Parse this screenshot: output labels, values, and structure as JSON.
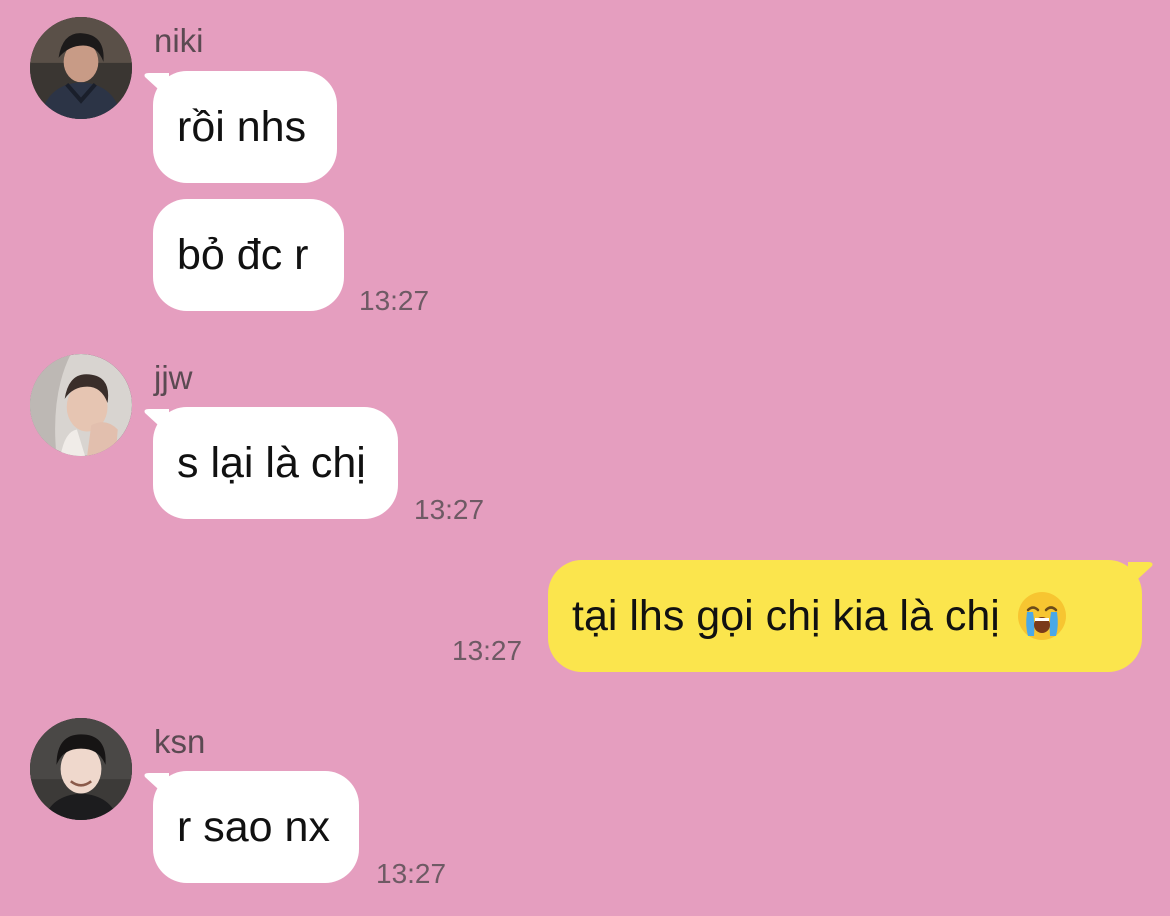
{
  "messages": [
    {
      "sender": "niki",
      "bubbles": [
        "rồi nhs",
        "bỏ đc r"
      ],
      "time": "13:27"
    },
    {
      "sender": "jjw",
      "bubbles": [
        "s lại là chị"
      ],
      "time": "13:27"
    },
    {
      "sender": "me",
      "bubbles": [
        "tại lhs gọi chị kia là chị"
      ],
      "emoji": "loudly-crying-face",
      "time": "13:27"
    },
    {
      "sender": "ksn",
      "bubbles": [
        "r sao nx"
      ],
      "time": "13:27"
    }
  ],
  "colors": {
    "background": "#e59ebf",
    "incoming_bubble": "#ffffff",
    "outgoing_bubble": "#fbe54d"
  }
}
